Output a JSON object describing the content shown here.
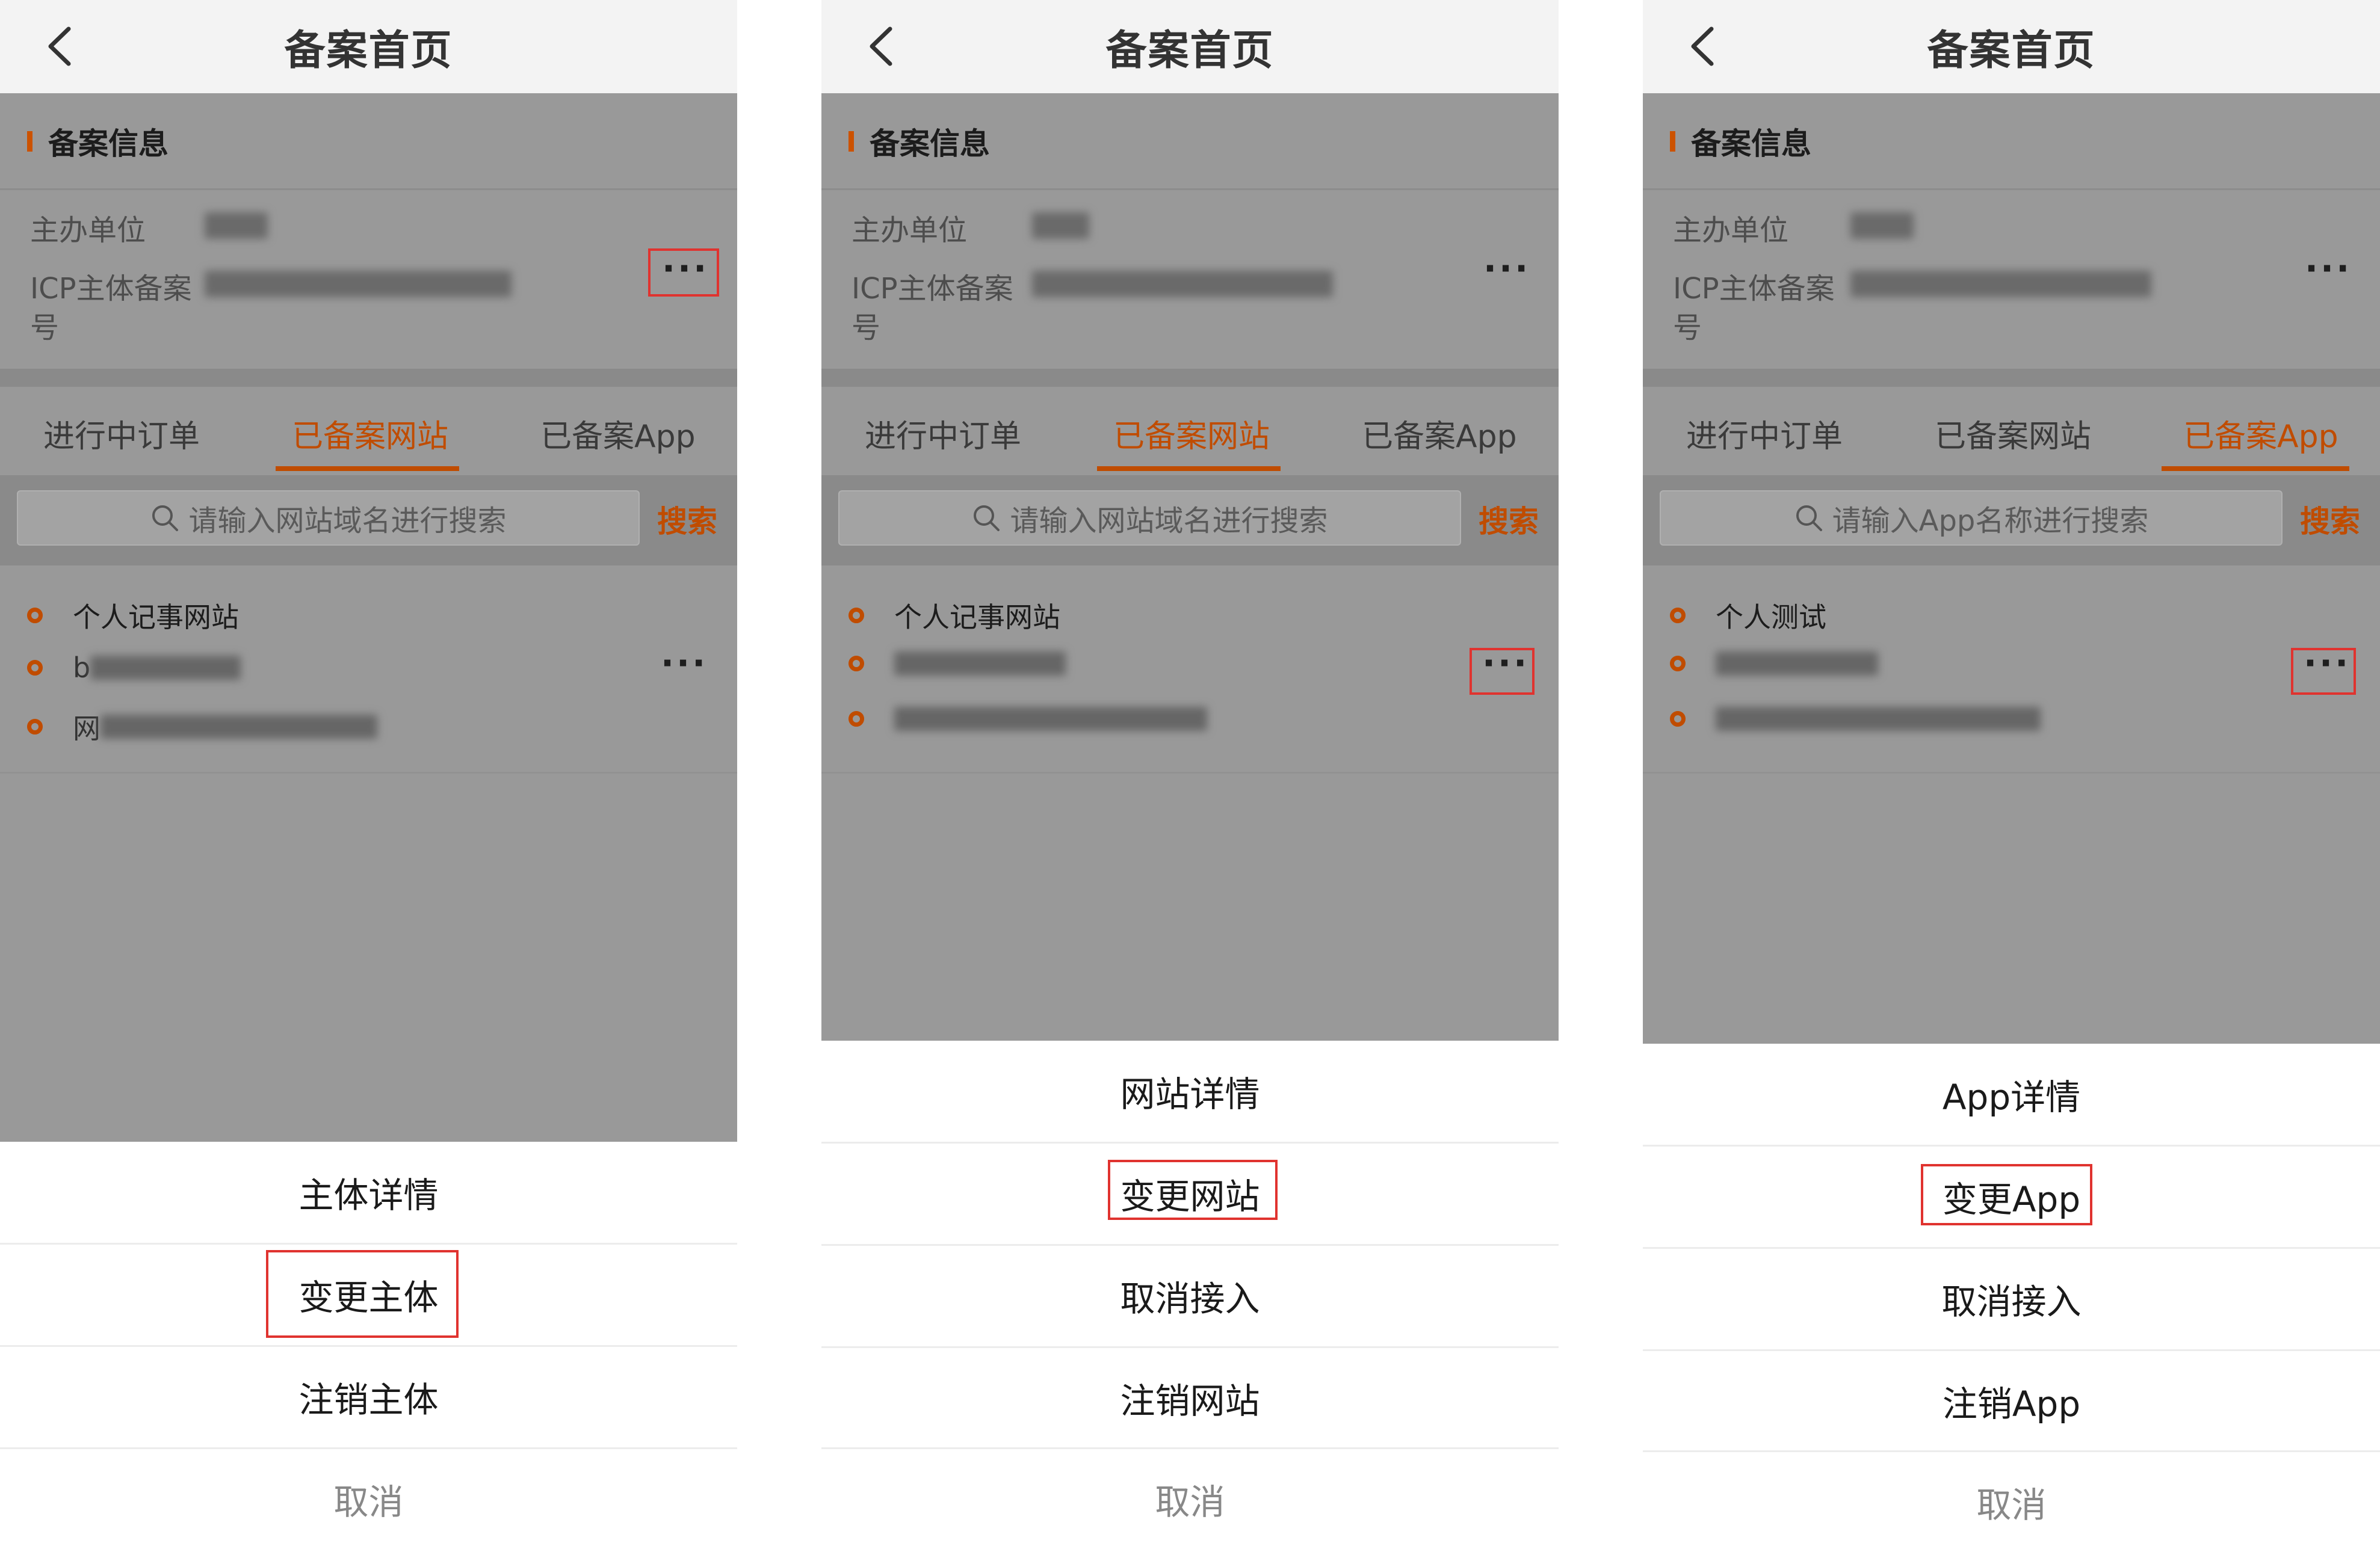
{
  "panels": [
    {
      "title": "备案首页",
      "section_title": "备案信息",
      "label_host": "主办单位",
      "label_icp": "ICP主体备案",
      "label_icp_cont": "号",
      "tabs": [
        "进行中订单",
        "已备案网站",
        "已备案App"
      ],
      "active_tab": 1,
      "search_placeholder": "请输入网站域名进行搜索",
      "search_button": "搜索",
      "list_first": "个人记事网站",
      "list_second_prefix": "b",
      "list_third_prefix": "网",
      "sheet": [
        "主体详情",
        "变更主体",
        "注销主体",
        "取消"
      ],
      "highlight_sheet_index": 1,
      "highlight_target": "header-more"
    },
    {
      "title": "备案首页",
      "section_title": "备案信息",
      "label_host": "主办单位",
      "label_icp": "ICP主体备案",
      "label_icp_cont": "号",
      "tabs": [
        "进行中订单",
        "已备案网站",
        "已备案App"
      ],
      "active_tab": 1,
      "search_placeholder": "请输入网站域名进行搜索",
      "search_button": "搜索",
      "list_first": "个人记事网站",
      "sheet": [
        "网站详情",
        "变更网站",
        "取消接入",
        "注销网站",
        "取消"
      ],
      "highlight_sheet_index": 1,
      "highlight_target": "item-more"
    },
    {
      "title": "备案首页",
      "section_title": "备案信息",
      "label_host": "主办单位",
      "label_icp": "ICP主体备案",
      "label_icp_cont": "号",
      "tabs": [
        "进行中订单",
        "已备案网站",
        "已备案App"
      ],
      "active_tab": 2,
      "search_placeholder": "请输入App名称进行搜索",
      "search_button": "搜索",
      "list_first": "个人测试",
      "sheet": [
        "App详情",
        "变更App",
        "取消接入",
        "注销App",
        "取消"
      ],
      "highlight_sheet_index": 1,
      "highlight_target": "item-more"
    }
  ],
  "colors": {
    "accent": "#c04c00",
    "highlight": "#e0332f",
    "overlay": "#999999"
  },
  "icons": {
    "back": "chevron-left-icon",
    "search": "search-icon",
    "more": "more-dots-icon"
  }
}
